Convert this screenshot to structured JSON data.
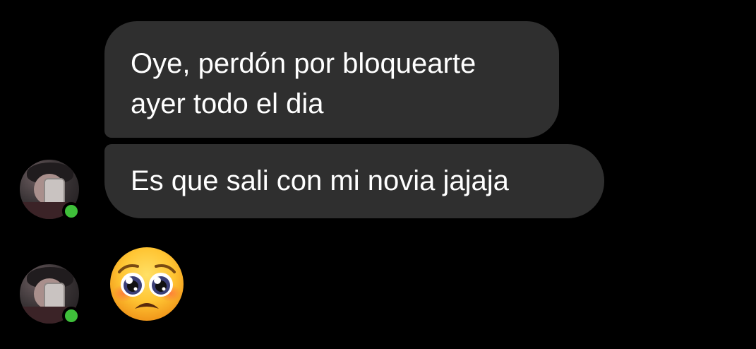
{
  "messages": [
    {
      "lines": [
        "Oye, perdón por bloquearte",
        "ayer todo el dia"
      ]
    },
    {
      "text": "Es que sali con mi novia jajaja"
    }
  ],
  "emoji_message": {
    "icon": "pleading-face-emoji"
  },
  "contact": {
    "avatar_icon": "user-avatar",
    "online_status_color": "#3fbf3a"
  },
  "colors": {
    "background": "#000000",
    "bubble": "#2f2f2f",
    "text": "#ffffff"
  }
}
